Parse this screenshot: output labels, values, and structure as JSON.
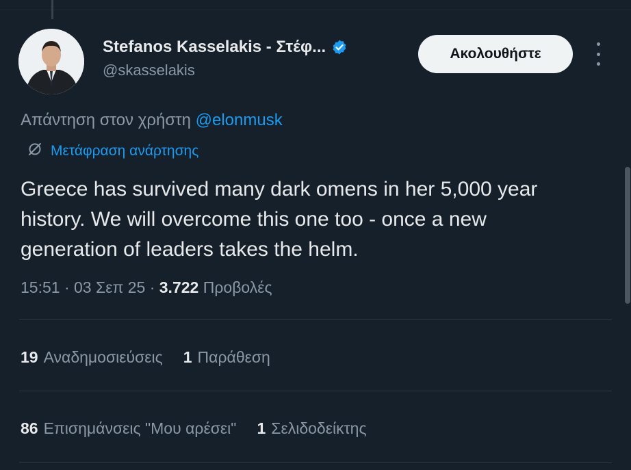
{
  "author": {
    "name": "Stefanos Kasselakis - Στέφ...",
    "handle": "@skasselakis",
    "verified": true
  },
  "follow_button": {
    "label": "Ακολουθήστε"
  },
  "reply_to": {
    "prefix": "Απάντηση στον χρήστη",
    "mention": "@elonmusk"
  },
  "translate": {
    "label": "Μετάφραση ανάρτησης",
    "icon": "globe-slash-icon"
  },
  "tweet": {
    "text": "Greece has survived many dark omens in her 5,000 year history. We will overcome this one too - once a new generation of leaders takes the helm.",
    "time": "15:51",
    "date": "03 Σεπ 25",
    "views_count": "3.722",
    "views_label": "Προβολές"
  },
  "stats": {
    "reposts": {
      "count": "19",
      "label": "Αναδημοσιεύσεις"
    },
    "quotes": {
      "count": "1",
      "label": "Παράθεση"
    },
    "likes": {
      "count": "86",
      "label": "Επισημάνσεις \"Μου αρέσει\""
    },
    "bookmarks": {
      "count": "1",
      "label": "Σελιδοδείκτης"
    }
  },
  "colors": {
    "background": "#15202b",
    "accent": "#1d9bf0",
    "muted": "#8b98a5",
    "text": "#e7e9ea"
  }
}
